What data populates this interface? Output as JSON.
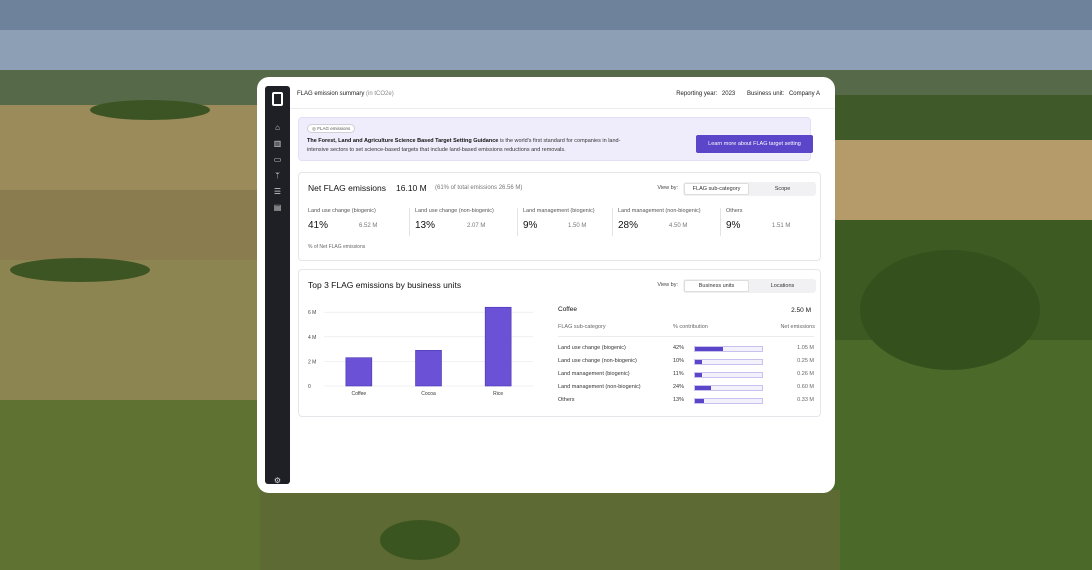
{
  "topbar": {
    "title": "FLAG emission summary",
    "title_unit": "(in tCO2e)",
    "reporting_year_label": "Reporting year:",
    "reporting_year": "2023",
    "business_unit_label": "Business unit:",
    "business_unit": "Company A"
  },
  "banner": {
    "badge": "FLAG emissions",
    "text_bold": "The Forest, Land and Agriculture Science Based Target Setting Guidance",
    "text_rest": " is the world's first standard for companies in land-intensive sectors to set science-based targets that include land-based emissions reductions and removals.",
    "button": "Learn more about FLAG target setting"
  },
  "net_panel": {
    "title": "Net FLAG emissions",
    "value": "16.10 M",
    "note": "(61% of total emissions 26.56 M)",
    "view_by": "View by:",
    "tabs": [
      "FLAG sub-category",
      "Scope"
    ],
    "active_tab": 0,
    "metrics": [
      {
        "label": "Land use change (biogenic)",
        "pct": "41%",
        "abs": "6.52 M"
      },
      {
        "label": "Land use change (non-biogenic)",
        "pct": "13%",
        "abs": "2.07 M"
      },
      {
        "label": "Land management (biogenic)",
        "pct": "9%",
        "abs": "1.50 M"
      },
      {
        "label": "Land management (non-biogenic)",
        "pct": "28%",
        "abs": "4.50 M"
      },
      {
        "label": "Others",
        "pct": "9%",
        "abs": "1.51 M"
      }
    ],
    "footnote": "% of Net FLAG emissions"
  },
  "top_panel": {
    "title": "Top 3 FLAG emissions by business units",
    "view_by": "View by:",
    "tabs": [
      "Business units",
      "Locations"
    ],
    "active_tab": 0
  },
  "chart_data": {
    "type": "bar",
    "categories": [
      "Coffee",
      "Cocoa",
      "Rice"
    ],
    "values": [
      2.3,
      2.9,
      6.4
    ],
    "y_tick_labels": [
      "0",
      "2 M",
      "4 M",
      "6 M"
    ],
    "ylim": [
      0,
      6.5
    ],
    "bar_color": "#6a51d6",
    "grid": true
  },
  "detail": {
    "name": "Coffee",
    "value": "2.50 M",
    "col_subcategory": "FLAG sub-category",
    "col_contribution": "% contribution",
    "col_net": "Net emissions",
    "rows": [
      {
        "name": "Land use change (biogenic)",
        "pct": "42%",
        "frac": 0.42,
        "value": "1.05 M"
      },
      {
        "name": "Land use change (non-biogenic)",
        "pct": "10%",
        "frac": 0.1,
        "value": "0.25 M"
      },
      {
        "name": "Land management (biogenic)",
        "pct": "11%",
        "frac": 0.11,
        "value": "0.26 M"
      },
      {
        "name": "Land management (non-biogenic)",
        "pct": "24%",
        "frac": 0.24,
        "value": "0.60 M"
      },
      {
        "name": "Others",
        "pct": "13%",
        "frac": 0.13,
        "value": "0.33 M"
      }
    ]
  },
  "colors": {
    "accent": "#5b45c9",
    "sidebar": "#1f2026"
  },
  "icons": [
    "logo-icon",
    "home-icon",
    "chart-icon",
    "wallet-icon",
    "branch-icon",
    "database-icon",
    "document-icon",
    "settings-icon"
  ]
}
